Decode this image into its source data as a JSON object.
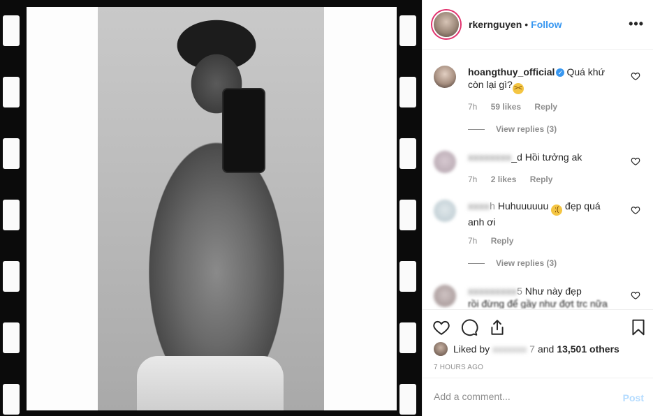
{
  "header": {
    "username": "rkernguyen",
    "separator": "•",
    "follow_label": "Follow",
    "more_label": "•••"
  },
  "comments": [
    {
      "username": "hoangthuy_official",
      "verified": true,
      "text_line1": "Quá khứ",
      "text_line2": "còn lại gì?",
      "emoji": "persevering-face-emoji",
      "time": "7h",
      "likes": "59 likes",
      "reply_label": "Reply",
      "view_replies": "View replies (3)"
    },
    {
      "username_visible": "_d",
      "text": "Hồi tưởng ak",
      "time": "7h",
      "likes": "2 likes",
      "reply_label": "Reply"
    },
    {
      "username_visible": "h",
      "text_line1": "Huhuuuuuu",
      "emoji": "crying-face-emoji",
      "text_after_emoji": "đẹp quá",
      "text_line2": "anh ơi",
      "time": "7h",
      "reply_label": "Reply",
      "view_replies": "View replies (3)"
    },
    {
      "username_visible": "5",
      "text_line1": "Như này đẹp",
      "text_line2": "rồi đừng để gầy như đợt trc nữa"
    }
  ],
  "likes": {
    "liked_by_label": "Liked by",
    "liked_by_user_visible": "7",
    "and_label": "and",
    "others_label": "13,501 others"
  },
  "timestamp": "7 HOURS AGO",
  "add_comment": {
    "placeholder": "Add a comment...",
    "post_label": "Post"
  },
  "colors": {
    "link_blue": "#3897f0",
    "post_disabled": "#b3dbff",
    "muted_text": "#8e8e8e",
    "border": "#efefef"
  }
}
